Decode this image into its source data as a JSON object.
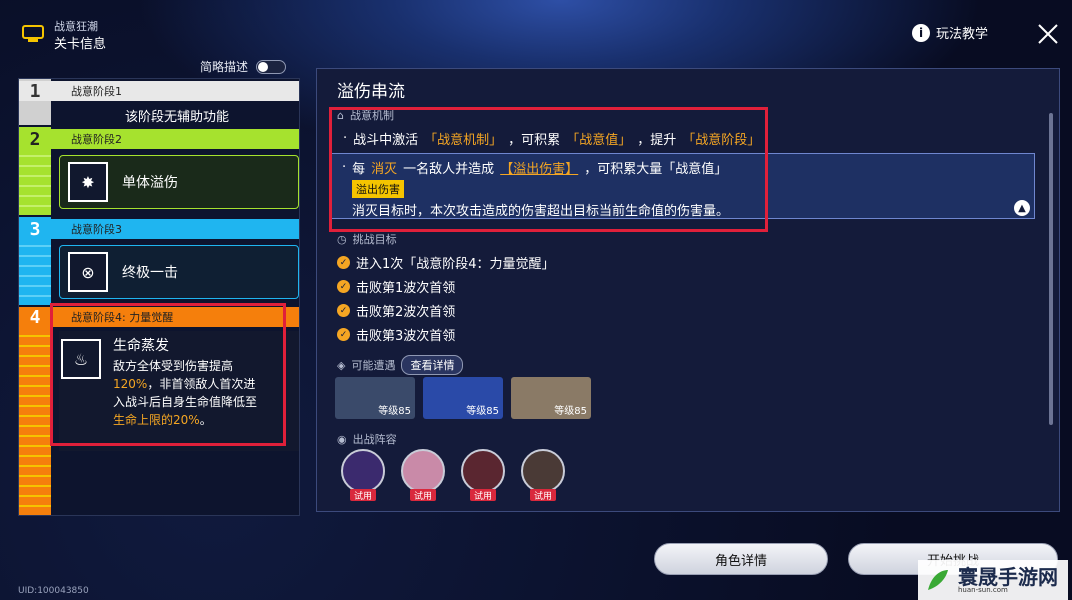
{
  "header": {
    "subtitle": "战意狂潮",
    "title": "关卡信息",
    "help_label": "玩法教学"
  },
  "brief_toggle": {
    "label": "简略描述",
    "on": false
  },
  "stages": [
    {
      "num": "1",
      "label": "战意阶段1",
      "desc": "该阶段无辅助功能",
      "color": "#e8e8e8"
    },
    {
      "num": "2",
      "label": "战意阶段2",
      "skill": "单体溢伤",
      "color": "#a6e22e"
    },
    {
      "num": "3",
      "label": "战意阶段3",
      "skill": "终极一击",
      "color": "#1fb5f0"
    },
    {
      "num": "4",
      "label": "战意阶段4: 力量觉醒",
      "skill": "生命蒸发",
      "color": "#f57f0c",
      "desc_1": "敌方全体受到伤害提高",
      "desc_2a": "120%",
      "desc_2b": "，非首领敌人首次进",
      "desc_3": "入战斗后自身生命值降低至",
      "desc_4a": "生命上限的20%",
      "desc_4b": "。"
    }
  ],
  "detail": {
    "title": "溢伤串流",
    "mechanic_label": "战意机制",
    "mechanic_line": {
      "a": "战斗中激活",
      "b": "「战意机制」",
      "c": "，可积累",
      "d": "「战意值」",
      "e": "，提升",
      "f": "「战意阶段」"
    },
    "highlight": {
      "a": "每",
      "b": "消灭",
      "c": "一名敌人并造成",
      "d": "【溢出伤害】",
      "e": "，可积累大量「战意值」",
      "tag": "溢出伤害",
      "desc": "消灭目标时，本次攻击造成的伤害超出目标当前生命值的伤害量。"
    },
    "challenge_label": "挑战目标",
    "challenges": [
      "进入1次「战意阶段4：力量觉醒」",
      "击败第1波次首领",
      "击败第2波次首领",
      "击败第3波次首领"
    ],
    "enemies_label": "可能遭遇",
    "details_button": "查看详情",
    "enemies": [
      {
        "level": "等级85",
        "color": "#3a4a6a"
      },
      {
        "level": "等级85",
        "color": "#2a4aa8"
      },
      {
        "level": "等级85",
        "color": "#8a7a66"
      }
    ],
    "lineup_label": "出战阵容",
    "trial_label": "试用",
    "lineup": [
      {
        "color": "#3b2a6e"
      },
      {
        "color": "#c98aa8"
      },
      {
        "color": "#5a2630"
      },
      {
        "color": "#4a3a36"
      }
    ]
  },
  "buttons": {
    "char_details": "角色详情",
    "start": "开始挑战"
  },
  "uid": "UID:100043850",
  "watermark": {
    "text": "寰晟手游网",
    "url": "huan-sun.com"
  }
}
